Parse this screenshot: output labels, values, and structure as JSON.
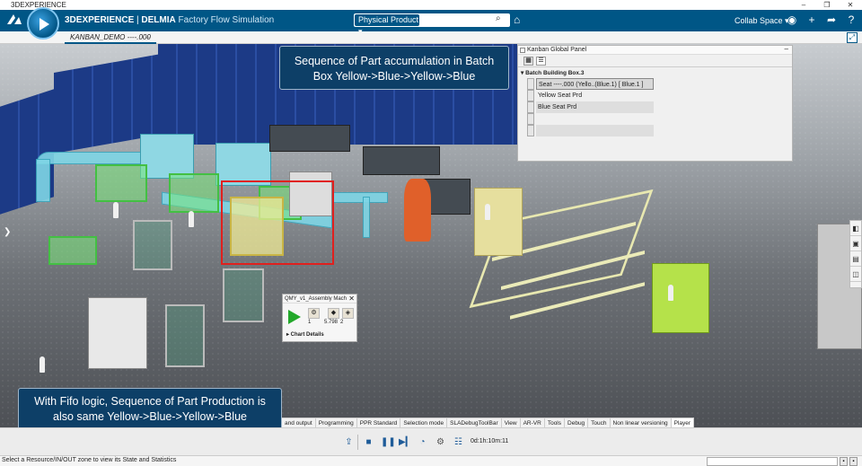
{
  "window": {
    "title": "3DEXPERIENCE",
    "controls": {
      "minimize": "–",
      "restore": "❐",
      "close": "✕"
    }
  },
  "topbar": {
    "brand_main": "3DEXPERIENCE",
    "brand_sep": " | ",
    "brand_app": "DELMIA",
    "brand_sub": "Factory Flow Simulation",
    "search_scope": "Physical Product ▾",
    "search_placeholder": "",
    "collab_space": "Collab Space ▾",
    "icons": [
      "user-icon",
      "add-icon",
      "share-icon",
      "help-icon"
    ]
  },
  "tabs": {
    "doc_tab": "KANBAN_DEMO ----.000",
    "add": "+"
  },
  "callouts": {
    "top": "Sequence of Part accumulation in Batch Box Yellow->Blue->Yellow->Blue",
    "bottom": "With Fifo logic, Sequence of Part Production is also same Yellow->Blue->Yellow->Blue"
  },
  "kanban_panel": {
    "title": "Kanban Global Panel",
    "section": "Batch Building Box.3",
    "rows": [
      {
        "label": "Seat ----.000 (Yello..(Blue.1) [ Blue.1 ]",
        "style": "sel"
      },
      {
        "label": "Yellow Seat Prd",
        "style": ""
      },
      {
        "label": "Blue Seat Prd",
        "style": "alt"
      },
      {
        "label": "",
        "style": ""
      },
      {
        "label": "",
        "style": "alt"
      }
    ]
  },
  "assembly_panel": {
    "title": "QMY_v1_Assembly Mach",
    "values": [
      "1",
      "5.798",
      "2"
    ],
    "details": "▸ Chart Details"
  },
  "command_tabs": [
    {
      "label": "and output",
      "active": false
    },
    {
      "label": "Programming",
      "active": false
    },
    {
      "label": "PPR Standard",
      "active": false
    },
    {
      "label": "Selection mode",
      "active": false
    },
    {
      "label": "SLADebugToolBar",
      "active": false
    },
    {
      "label": "View",
      "active": false
    },
    {
      "label": "AR-VR",
      "active": false
    },
    {
      "label": "Tools",
      "active": false
    },
    {
      "label": "Debug",
      "active": false
    },
    {
      "label": "Touch",
      "active": false
    },
    {
      "label": "Non linear versioning",
      "active": false
    },
    {
      "label": "Player",
      "active": true
    }
  ],
  "player": {
    "time": "0d:1h:10m:11",
    "icons": [
      "export-icon",
      "stop-icon",
      "pause-icon",
      "step-icon",
      "speed-icon",
      "settings-icon",
      "list-icon"
    ]
  },
  "status": {
    "text": "Select a Resource/IN/OUT zone to view its State and Statistics"
  }
}
